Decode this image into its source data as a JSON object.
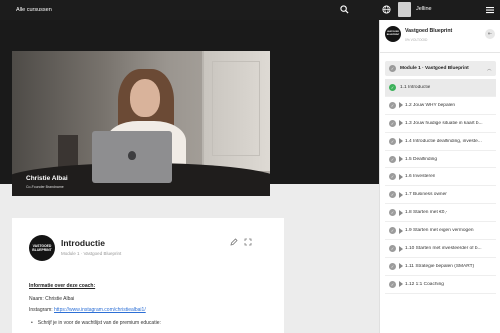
{
  "topbar": {
    "all_courses": "Alle cursussen",
    "search_icon": "search-icon",
    "globe_icon": "globe-icon",
    "user_name": "Jelline",
    "menu_icon": "hamburger-menu-icon"
  },
  "video": {
    "presenter_name": "Christie Albai",
    "presenter_subtitle": "Co-Founder Brandname"
  },
  "lesson": {
    "logo_line1": "VASTGOED",
    "logo_line2": "BLUEPRINT",
    "title": "Introductie",
    "subtitle": "Module 1 · Vastgoed Blueprint",
    "info_heading": "Informatie over deze coach:",
    "name_line": "Naam: Christie Albai",
    "insta_label": "Instagram: ",
    "insta_link": "https://www.instagram.com/christiealbai1/",
    "bullet_1": "Schrijf je in voor de wachtlijst van de premium educatie:"
  },
  "sidebar": {
    "course_logo_line1": "VASTGOED",
    "course_logo_line2": "BLUEPRINT",
    "course_title": "Vastgoed Blueprint",
    "course_progress": "0% VOLTOOID",
    "module_label": "Module 1 · Vastgoed Blueprint",
    "lessons": [
      {
        "label": "1.1 Introductie"
      },
      {
        "label": "1.2 Jouw WHY bepalen"
      },
      {
        "label": "1.3 Jouw huidige situatie in kaart b..."
      },
      {
        "label": "1.4 Introductie dealfinding, investe..."
      },
      {
        "label": "1.5 Dealfinding"
      },
      {
        "label": "1.6 Investeren"
      },
      {
        "label": "1.7 Business owner"
      },
      {
        "label": "1.8 Starten met €0,-"
      },
      {
        "label": "1.9 Starten met eigen vermogen"
      },
      {
        "label": "1.10 Starten met investeerder of b..."
      },
      {
        "label": "1.11 Strategie bepalen (SMART)"
      },
      {
        "label": "1.12 1:1 Coaching"
      }
    ]
  }
}
